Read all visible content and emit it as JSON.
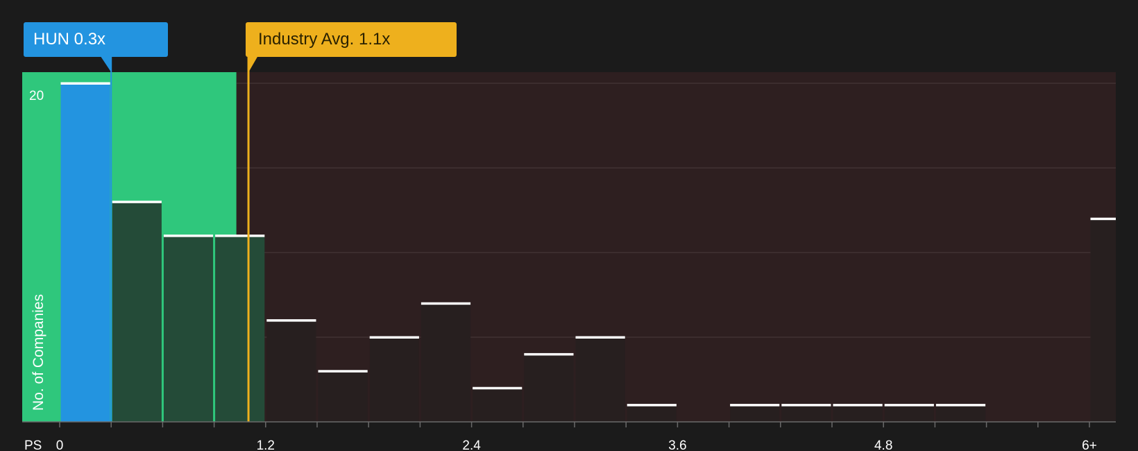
{
  "company_callout": {
    "ticker": "HUN",
    "value_label": "0.3x"
  },
  "industry_callout": {
    "label": "Industry Avg. 1.1x"
  },
  "colors": {
    "background": "#1b1b1b",
    "company_bar": "#2394e0",
    "fair_zone": "#2fc77c",
    "fair_bar": "#244b38",
    "over_zone": "#2e1f20",
    "over_bar": "#271f1f",
    "industry": "#eeb01d",
    "bar_top": "#ffffff"
  },
  "chart_data": {
    "type": "bar",
    "title": "",
    "xlabel": "PS",
    "ylabel": "No. of Companies",
    "x_tick_labels": [
      "0",
      "1.2",
      "2.4",
      "3.6",
      "4.8",
      "6+"
    ],
    "x_ticks": [
      0,
      1.2,
      2.4,
      3.6,
      4.8,
      6
    ],
    "y_tick_labels": [
      "20"
    ],
    "ylim": [
      0,
      20.7
    ],
    "xlim": [
      -0.22,
      6.15
    ],
    "gridlines_y": [
      5,
      10,
      15,
      20
    ],
    "bin_width": 0.3,
    "bins": [
      {
        "start": 0.0,
        "count": 20
      },
      {
        "start": 0.3,
        "count": 13
      },
      {
        "start": 0.6,
        "count": 11
      },
      {
        "start": 0.9,
        "count": 11
      },
      {
        "start": 1.2,
        "count": 6
      },
      {
        "start": 1.5,
        "count": 3
      },
      {
        "start": 1.8,
        "count": 5
      },
      {
        "start": 2.1,
        "count": 7
      },
      {
        "start": 2.4,
        "count": 2
      },
      {
        "start": 2.7,
        "count": 4
      },
      {
        "start": 3.0,
        "count": 5
      },
      {
        "start": 3.3,
        "count": 1
      },
      {
        "start": 3.6,
        "count": 0
      },
      {
        "start": 3.9,
        "count": 1
      },
      {
        "start": 4.2,
        "count": 1
      },
      {
        "start": 4.5,
        "count": 1
      },
      {
        "start": 4.8,
        "count": 1
      },
      {
        "start": 5.1,
        "count": 1
      },
      {
        "start": 5.4,
        "count": 0
      },
      {
        "start": 5.7,
        "count": 0
      },
      {
        "start": 6.0,
        "count": 12
      }
    ],
    "company_value": 0.3,
    "industry_avg": 1.1,
    "fair_zone_end": 1.03
  }
}
